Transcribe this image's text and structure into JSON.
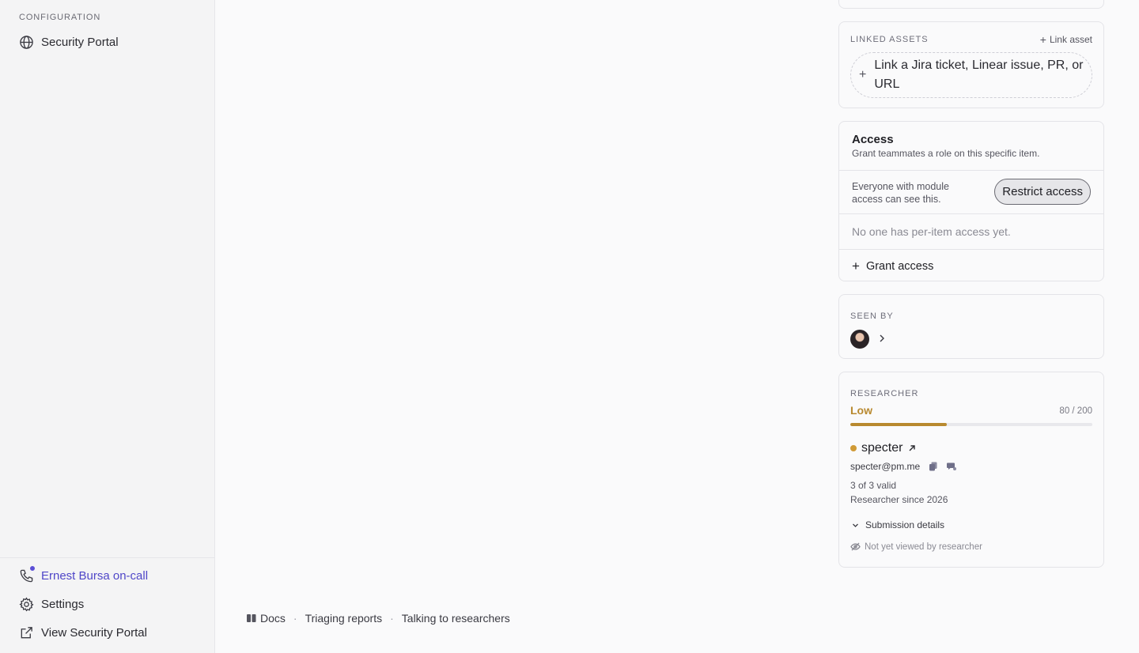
{
  "sidebar": {
    "section_label": "CONFIGURATION",
    "top_item": {
      "label": "Security Portal",
      "icon": "globe-icon"
    },
    "bottom_items": [
      {
        "label": "Ernest Bursa on-call",
        "icon": "phone-icon",
        "has_dot": true
      },
      {
        "label": "Settings",
        "icon": "gear-icon"
      },
      {
        "label": "View Security Portal",
        "icon": "external-link-icon"
      }
    ]
  },
  "footer": {
    "docs": "Docs",
    "link1": "Triaging reports",
    "link2": "Talking to researchers",
    "separator": "·"
  },
  "linked_assets": {
    "label": "LINKED ASSETS",
    "link_action": "Link asset",
    "placeholder": "Link a Jira ticket, Linear issue, PR, or URL"
  },
  "access": {
    "title": "Access",
    "subtitle": "Grant teammates a role on this specific item.",
    "visibility_text": "Everyone with module access can see this.",
    "restrict_label": "Restrict access",
    "empty_text": "No one has per-item access yet.",
    "grant_label": "Grant access"
  },
  "seen_by": {
    "label": "SEEN BY"
  },
  "researcher": {
    "label": "RESEARCHER",
    "level": "Low",
    "score_text": "80 / 200",
    "score_fraction": 0.4,
    "handle": "specter",
    "email": "specter@pm.me",
    "valid_text": "3 of 3 valid",
    "since_text": "Researcher since 2026",
    "details_label": "Submission details",
    "viewed_text": "Not yet viewed by researcher",
    "colors": {
      "level": "#b8892f",
      "status_dot": "#d09a36",
      "accent": "#4f46c8"
    }
  }
}
